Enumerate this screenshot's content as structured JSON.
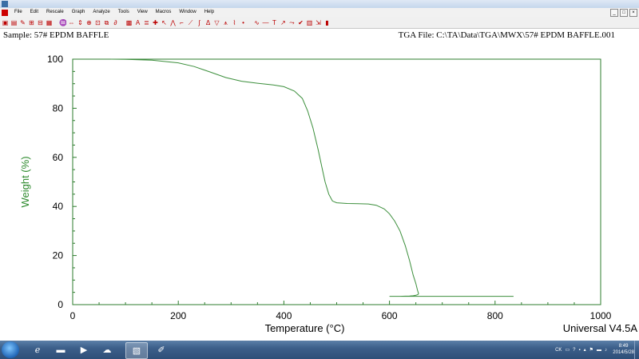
{
  "menu": [
    "File",
    "Edit",
    "Rescale",
    "Graph",
    "Analyze",
    "Tools",
    "View",
    "Macros",
    "Window",
    "Help"
  ],
  "window_controls": [
    "_",
    "□",
    "×"
  ],
  "header": {
    "sample": "Sample: 57# EPDM BAFFLE",
    "file": "TGA File: C:\\TA\\Data\\TGA\\MWX\\57# EPDM BAFFLE.001"
  },
  "version": "Universal V4.5A",
  "colors": {
    "curve": "#3c8f3c",
    "axis": "#2d7d2d",
    "ylabel": "#2d8a2d"
  },
  "chart_data": {
    "type": "line",
    "xlabel": "Temperature (°C)",
    "ylabel": "Weight (%)",
    "xlim": [
      0,
      1000
    ],
    "ylim": [
      0,
      100
    ],
    "xticks": [
      0,
      200,
      400,
      600,
      800,
      1000
    ],
    "yticks": [
      0,
      20,
      40,
      60,
      80,
      100
    ],
    "grid": false,
    "series": [
      {
        "x": [
          72,
          100,
          150,
          200,
          230,
          260,
          290,
          320,
          350,
          380,
          400,
          420,
          435,
          445,
          455,
          465,
          472,
          478,
          485,
          492,
          500,
          520,
          540,
          560,
          575,
          590,
          600,
          610,
          620,
          630,
          638,
          645,
          650,
          653,
          655,
          654,
          650,
          645,
          638,
          630,
          620,
          600,
          700,
          800,
          835
        ],
        "y": [
          100,
          99.9,
          99.6,
          98.5,
          97,
          94.8,
          92.5,
          91,
          90.2,
          89.5,
          88.8,
          87,
          84,
          79,
          72,
          63,
          56,
          50,
          45,
          42.2,
          41.5,
          41.2,
          41.1,
          41,
          40.5,
          39,
          37,
          34,
          30,
          24,
          18,
          12,
          8.5,
          6,
          4.5,
          4.1,
          3.8,
          3.6,
          3.5,
          3.45,
          3.4,
          3.4,
          3.4,
          3.4,
          3.4
        ]
      }
    ]
  },
  "taskbar": {
    "items": [
      "start-orb",
      "ie-icon",
      "folder-icon",
      "media-player-icon",
      "network-icon",
      "universal-analysis-icon",
      "paint-icon"
    ],
    "tray_text": "CK",
    "time": "8:49",
    "date": "2014/5/28"
  }
}
